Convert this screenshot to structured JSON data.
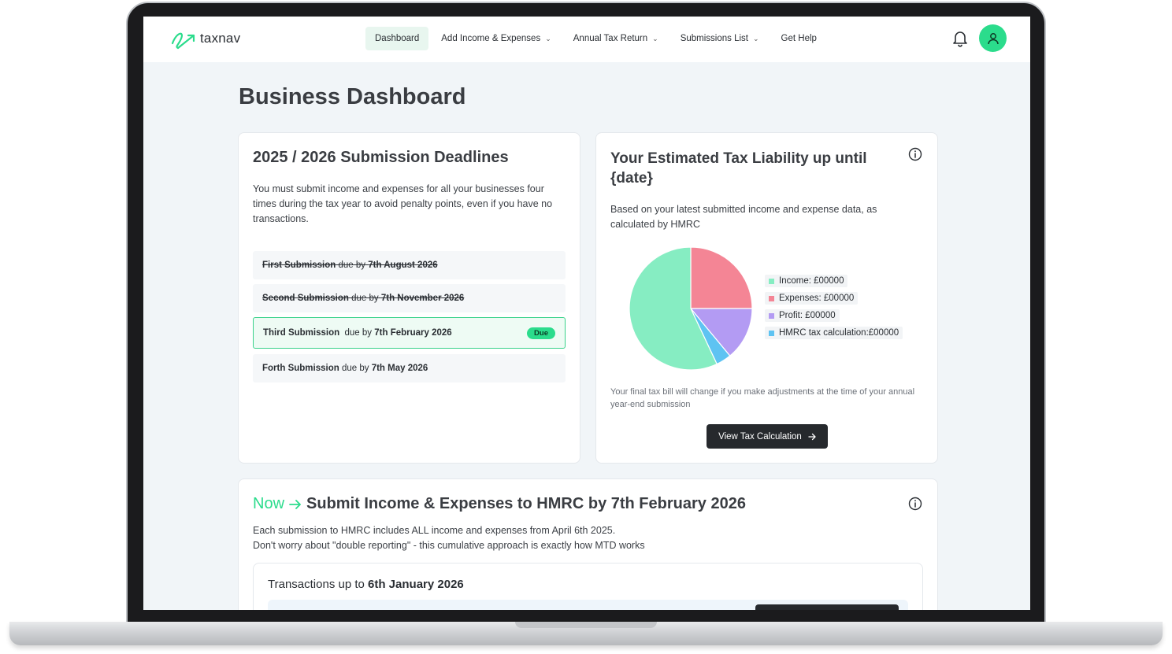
{
  "brand": {
    "name": "taxnav",
    "accent": "#2bdc8c"
  },
  "nav": {
    "items": [
      {
        "label": "Dashboard",
        "active": true,
        "dropdown": false
      },
      {
        "label": "Add Income & Expenses",
        "active": false,
        "dropdown": true
      },
      {
        "label": "Annual Tax Return",
        "active": false,
        "dropdown": true
      },
      {
        "label": "Submissions List",
        "active": false,
        "dropdown": true
      },
      {
        "label": "Get Help",
        "active": false,
        "dropdown": false
      }
    ],
    "icons": {
      "bell": "bell-icon",
      "avatar": "user-icon"
    }
  },
  "page": {
    "title": "Business Dashboard"
  },
  "deadlines": {
    "title": "2025 / 2026 Submission Deadlines",
    "description": "You must submit income and expenses for all your businesses four times during the tax year to avoid penalty points, even if you have no transactions.",
    "due_by_text": "due by",
    "submissions": [
      {
        "name": "First Submission",
        "date": "7th August 2026",
        "status": "done"
      },
      {
        "name": "Second Submission",
        "date": "7th November 2026",
        "status": "done"
      },
      {
        "name": "Third Submission",
        "date": "7th February 2026",
        "status": "current",
        "badge": "Due"
      },
      {
        "name": "Forth Submission",
        "date": "7th May 2026",
        "status": "upcoming"
      }
    ]
  },
  "tax": {
    "title": "Your Estimated Tax Liability up until {date}",
    "description": "Based on your latest submitted income and expense data, as calculated by HMRC",
    "legend": [
      {
        "label": "Income: £00000",
        "color": "#86edc2"
      },
      {
        "label": "Expenses: £00000",
        "color": "#f48595"
      },
      {
        "label": "Profit: £00000",
        "color": "#b39bf3"
      },
      {
        "label": "HMRC tax calculation:£00000",
        "color": "#5ec3f2"
      }
    ],
    "note": "Your final tax bill will change if you make adjustments at the time of your annual year-end submission",
    "button": "View Tax Calculation"
  },
  "chart_data": {
    "type": "pie",
    "categories": [
      "Income",
      "Expenses",
      "Profit",
      "HMRC tax calculation"
    ],
    "values": [
      57,
      25,
      14,
      4
    ],
    "colors": [
      "#86edc2",
      "#f48595",
      "#b39bf3",
      "#5ec3f2"
    ],
    "legend": "right"
  },
  "submit": {
    "now_label": "Now",
    "title": "Submit Income & Expenses to HMRC by 7th February 2026",
    "line1": "Each submission to HMRC  includes ALL income and expenses from April 6th 2025.",
    "line2": "Don't worry about \"double reporting\" - this cumulative approach is exactly how MTD works",
    "transactions_prefix": "Transactions up to",
    "transactions_date": "6th January 2026"
  }
}
